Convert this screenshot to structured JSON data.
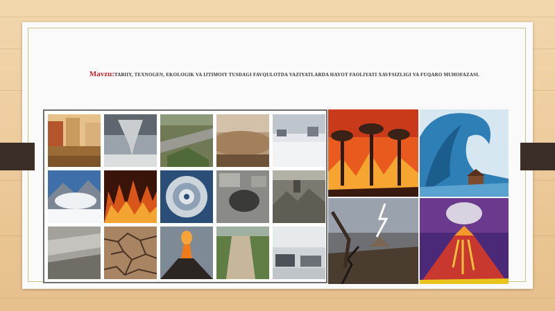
{
  "slide": {
    "title_label": "Mavzu:",
    "title_text": "TABIIY, TEXNOGEN, EKOLOGIK VA IJTIMOIY TUSDAGI FAVQULOTDA VAZIYATLARDA HAYOT FAOLIYATI XAVFSIZLIGI VA FUQARO MUHOFAZASI."
  },
  "photo_grid": {
    "tiles": [
      {
        "icon": "flood-photo"
      },
      {
        "icon": "tornado-photo"
      },
      {
        "icon": "landslide-road-photo"
      },
      {
        "icon": "dust-storm-photo"
      },
      {
        "icon": "snow-storm-photo"
      },
      {
        "icon": "avalanche-photo"
      },
      {
        "icon": "forest-fire-photo"
      },
      {
        "icon": "hurricane-satellite-photo"
      },
      {
        "icon": "sinkhole-photo"
      },
      {
        "icon": "earthquake-ruins-photo"
      },
      {
        "icon": "mudflow-photo"
      },
      {
        "icon": "drought-cracked-earth-photo"
      },
      {
        "icon": "volcano-eruption-photo"
      },
      {
        "icon": "landslide-hill-photo"
      },
      {
        "icon": "ice-storm-photo"
      }
    ]
  },
  "illustrations": [
    {
      "icon": "wildfire-illustration"
    },
    {
      "icon": "tsunami-illustration"
    },
    {
      "icon": "earthquake-storm-illustration"
    },
    {
      "icon": "volcano-illustration"
    }
  ],
  "colors": {
    "accent": "#c0272d",
    "text": "#333333",
    "slide_bg": "#fafafa",
    "tab": "#3b2e26"
  }
}
